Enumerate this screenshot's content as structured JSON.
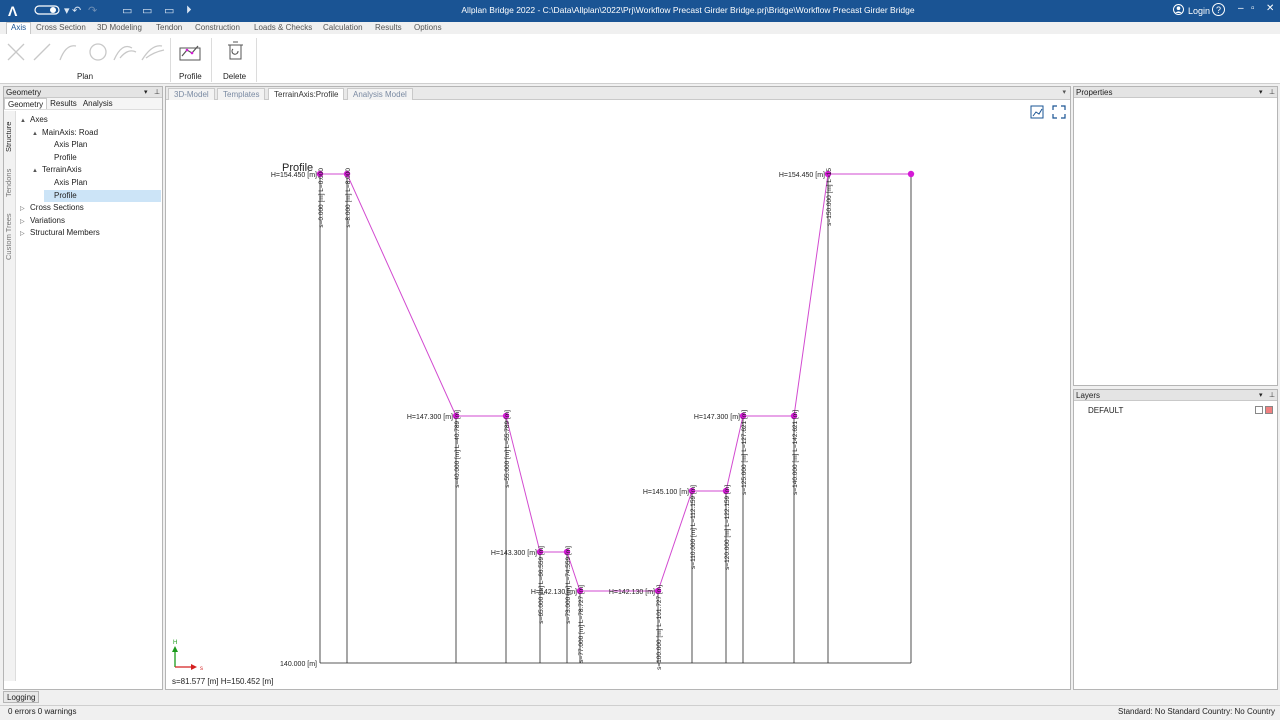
{
  "app": {
    "title": "Allplan Bridge 2022 - C:\\Data\\Allplan\\2022\\Prj\\Workflow Precast Girder Bridge.prj\\Bridge\\Workflow Precast Girder Bridge",
    "login_label": "Login",
    "help_label": "?",
    "logo": "Λ"
  },
  "ribbon": {
    "tabs": [
      "Axis",
      "Cross Section",
      "3D Modeling",
      "Tendon",
      "Construction",
      "Loads & Checks",
      "Calculation",
      "Results",
      "Options"
    ],
    "active_tab": "Axis",
    "groups": {
      "plan_label": "Plan",
      "profile_label": "Profile",
      "delete_label": "Delete"
    }
  },
  "left_panel": {
    "title": "Geometry",
    "tabs": [
      "Geometry",
      "Results",
      "Analysis"
    ],
    "vertical_tabs": [
      "Structure",
      "Tendons",
      "Custom Trees"
    ],
    "tree": [
      {
        "label": "Axes",
        "level": 0,
        "toggle": "▲"
      },
      {
        "label": "MainAxis: Road",
        "level": 1,
        "toggle": "▲"
      },
      {
        "label": "Axis Plan",
        "level": 2,
        "toggle": ""
      },
      {
        "label": "Profile",
        "level": 2,
        "toggle": ""
      },
      {
        "label": "TerrainAxis",
        "level": 1,
        "toggle": "▲"
      },
      {
        "label": "Axis Plan",
        "level": 2,
        "toggle": ""
      },
      {
        "label": "Profile",
        "level": 2,
        "toggle": "",
        "selected": true
      },
      {
        "label": "Cross Sections",
        "level": 0,
        "toggle": "▷"
      },
      {
        "label": "Variations",
        "level": 0,
        "toggle": "▷"
      },
      {
        "label": "Structural Members",
        "level": 0,
        "toggle": "▷"
      }
    ]
  },
  "document_tabs": [
    "3D-Model",
    "Templates",
    "TerrainAxis:Profile",
    "Analysis Model"
  ],
  "active_document_tab": "TerrainAxis:Profile",
  "drawing": {
    "title": "Profile",
    "base_label": "140.000 [m]",
    "axis_h_label": "H",
    "axis_s_label": "s",
    "line_color": "#d24ad0",
    "point_color": "#d41ad6",
    "points": [
      {
        "s_label": "s=0.000 [m] L=0.000",
        "h_label": "H=154.450 [m]"
      },
      {
        "s_label": "s=8.000 [m] L=8.000",
        "h_label": "H=154.450 [m]"
      },
      {
        "s_label": "s=40.000 [m] L=40.789 [m]",
        "h_label": "H=147.300 [m]"
      },
      {
        "s_label": "s=55.000 [m] L=55.789 [m]",
        "h_label": "H=147.300 [m]"
      },
      {
        "s_label": "s=65.000 [m] L=66.559 [m]",
        "h_label": "H=143.300 [m]"
      },
      {
        "s_label": "s=73.000 [m] L=74.559 [m]",
        "h_label": "H=143.300 [m]"
      },
      {
        "s_label": "s=77.000 [m] L=78.727 [m]",
        "h_label": "H=142.130 [m]"
      },
      {
        "s_label": "s=100.000 [m] L=101.727 [m]",
        "h_label": "H=142.130 [m]"
      },
      {
        "s_label": "s=110.000 [m] L=112.159 [m]",
        "h_label": "H=145.100 [m]"
      },
      {
        "s_label": "s=120.000 [m] L=122.159 [m]",
        "h_label": "H=145.100 [m]"
      },
      {
        "s_label": "s=125.000 [m] L=127.621 [m]",
        "h_label": "H=147.300 [m]"
      },
      {
        "s_label": "s=140.000 [m] L=142.621 [m]",
        "h_label": "H=147.300 [m]"
      },
      {
        "s_label": "s=150.000 [m] L=15",
        "h_label": "H=154.450 [m]"
      },
      {
        "s_label": "",
        "h_label": ""
      }
    ],
    "coord_readout": "s=81.577 [m] H=150.452 [m]"
  },
  "properties_panel": {
    "title": "Properties"
  },
  "layers_panel": {
    "title": "Layers",
    "layers": [
      {
        "name": "DEFAULT",
        "color": "#f08080"
      }
    ]
  },
  "logging_tab": "Logging",
  "status": {
    "left": "0 errors 0 warnings",
    "right": "Standard: No Standard Country: No Country"
  }
}
